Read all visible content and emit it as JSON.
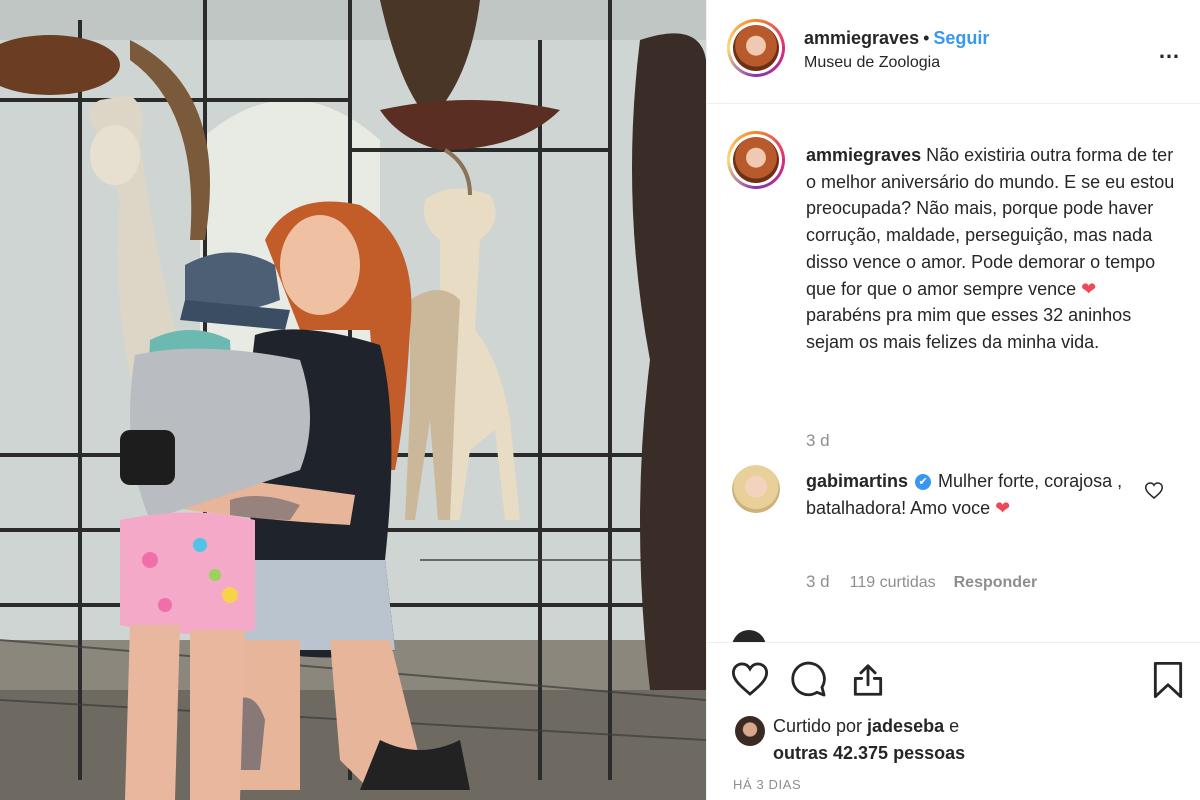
{
  "post": {
    "username": "ammiegraves",
    "separator": "•",
    "follow_label": "Seguir",
    "location": "Museu de Zoologia",
    "more_icon": "…"
  },
  "caption": {
    "username": "ammiegraves",
    "text_before_heart": " Não existiria outra forma de ter o melhor aniversário do mundo. E se eu estou preocupada? Não mais, porque pode haver corrução, maldade, perseguição, mas nada disso vence o amor. Pode demorar o tempo que for que o amor sempre vence ",
    "heart": "❤",
    "text_after_heart": " parabéns pra mim que esses 32 aninhos sejam os mais felizes da minha vida.",
    "time": "3 d"
  },
  "comment": {
    "username": "gabimartins",
    "verified_icon": "✔",
    "text": " Mulher forte, corajosa , batalhadora! Amo voce ",
    "heart": "❤",
    "time": "3 d",
    "likes": "119 curtidas",
    "reply_label": "Responder"
  },
  "footer": {
    "liked_prefix": "Curtido por ",
    "liked_user": "jadeseba",
    "liked_middle": " e ",
    "liked_others": "outras 42.375 pessoas",
    "date": "HÁ 3 DIAS"
  },
  "icons": {
    "like": "heart-icon",
    "comment": "comment-icon",
    "share": "share-icon",
    "save": "bookmark-icon"
  },
  "colors": {
    "accent": "#3897f0",
    "heart": "#ed4956",
    "muted": "#8e8e8e",
    "text": "#262626",
    "border": "#efefef"
  }
}
